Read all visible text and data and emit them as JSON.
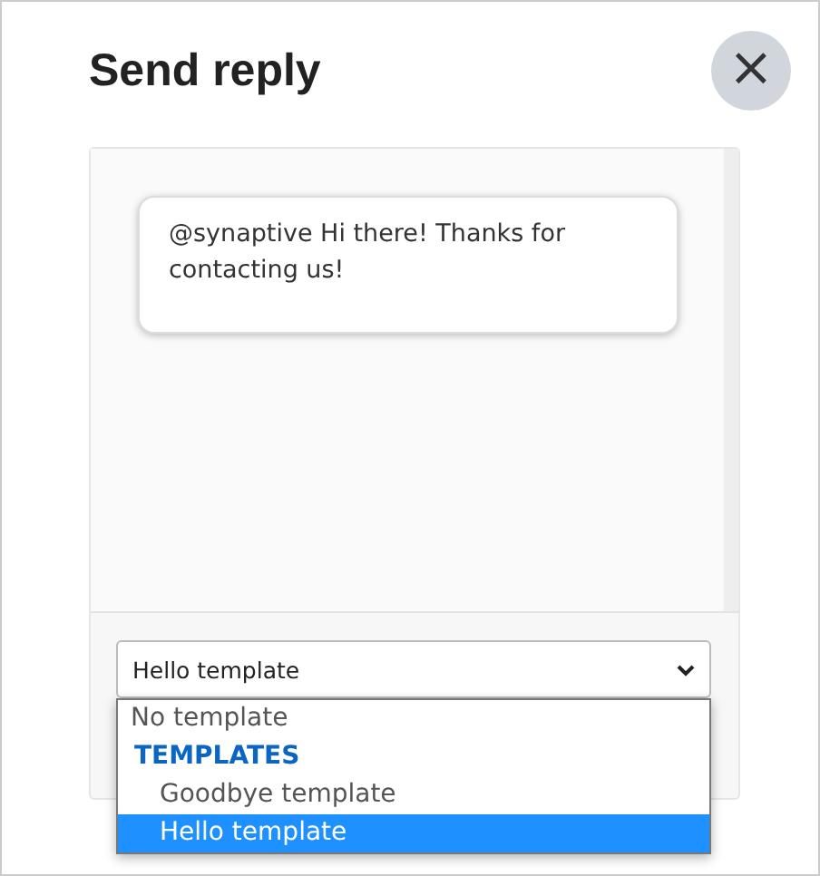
{
  "dialog": {
    "title": "Send reply",
    "close_button": "×"
  },
  "message": {
    "text": "@synaptive Hi there! Thanks for contacting us!"
  },
  "template_select": {
    "value": "Hello template",
    "expanded": true,
    "options": [
      {
        "kind": "option",
        "label": "No template",
        "selected": false
      },
      {
        "kind": "group",
        "label": "TEMPLATES"
      },
      {
        "kind": "suboption",
        "label": "Goodbye template",
        "selected": false
      },
      {
        "kind": "suboption",
        "label": "Hello template",
        "selected": true
      }
    ]
  }
}
